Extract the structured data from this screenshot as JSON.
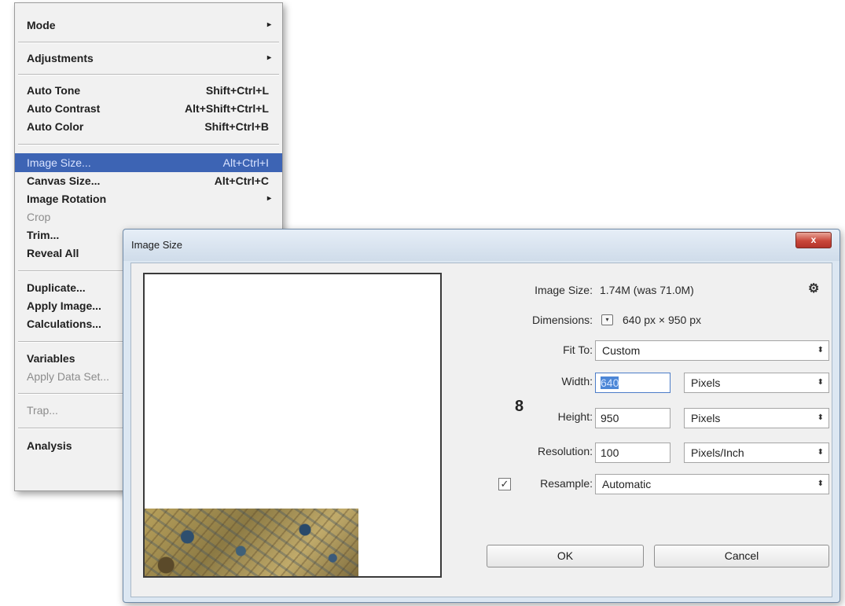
{
  "menu": {
    "items": [
      {
        "label": "Mode",
        "submenu": true
      },
      {
        "label": "Adjustments",
        "submenu": true
      },
      {
        "label": "Auto Tone",
        "shortcut": "Shift+Ctrl+L"
      },
      {
        "label": "Auto Contrast",
        "shortcut": "Alt+Shift+Ctrl+L"
      },
      {
        "label": "Auto Color",
        "shortcut": "Shift+Ctrl+B"
      },
      {
        "label": "Image Size...",
        "shortcut": "Alt+Ctrl+I",
        "selected": true
      },
      {
        "label": "Canvas Size...",
        "shortcut": "Alt+Ctrl+C"
      },
      {
        "label": "Image Rotation",
        "submenu": true
      },
      {
        "label": "Crop",
        "disabled": true
      },
      {
        "label": "Trim..."
      },
      {
        "label": "Reveal All"
      },
      {
        "label": "Duplicate..."
      },
      {
        "label": "Apply Image..."
      },
      {
        "label": "Calculations..."
      },
      {
        "label": "Variables"
      },
      {
        "label": "Apply Data Set...",
        "disabled": true
      },
      {
        "label": "Trap...",
        "disabled": true
      },
      {
        "label": "Analysis"
      }
    ],
    "submenu_arrow": "▸"
  },
  "dialog": {
    "title": "Image Size",
    "close_label": "x",
    "image_size_label": "Image Size:",
    "image_size_value": "1.74M (was 71.0M)",
    "dimensions_label": "Dimensions:",
    "dimensions_value": "640 px × 950 px",
    "fit_to_label": "Fit To:",
    "fit_to_value": "Custom",
    "width_label": "Width:",
    "width_value": "640",
    "width_unit": "Pixels",
    "height_label": "Height:",
    "height_value": "950",
    "height_unit": "Pixels",
    "resolution_label": "Resolution:",
    "resolution_value": "100",
    "resolution_unit": "Pixels/Inch",
    "resample_checked": true,
    "resample_label": "Resample:",
    "resample_value": "Automatic",
    "ok_label": "OK",
    "cancel_label": "Cancel"
  },
  "colors": {
    "menu_selected": "#3d64b4",
    "close_button": "#c9473a",
    "dialog_frame": "#dce7f2"
  },
  "icons": {
    "gear": "⚙",
    "link": "8",
    "updown": "⬍",
    "expand": "▾",
    "check": "✓"
  }
}
